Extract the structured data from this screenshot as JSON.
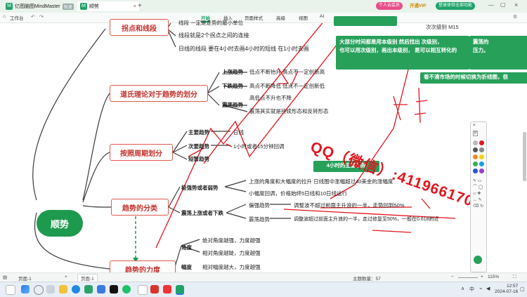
{
  "titlebar": {
    "tab1": "亿图脑图MindMaster",
    "tab1_badge": "极速",
    "tab2": "顺势",
    "badge_pink": "个人云会员",
    "vip": "开通VIP",
    "login": "登录体验全部功能"
  },
  "ribbon": {
    "workspace": "工作台",
    "tabs": [
      "开始",
      "插入",
      "页面样式",
      "高级",
      "视图",
      "AI"
    ],
    "active": "开始"
  },
  "map": {
    "central": "顺势",
    "topics": {
      "t1": "拐点和线段",
      "t2": "道氏理论对于趋势的划分",
      "t3": "按照周期划分",
      "t4": "趋势的分类",
      "t5": "趋势的力度"
    },
    "t1_items": [
      "线段 一定是走势的最小单位",
      "线段就是2个拐点之间的连接",
      "日线的线段 要在4小时去画4小时的短线 在1小时去画"
    ],
    "t2_items": {
      "up": "上涨趋势",
      "up_desc": "低点不断抬升 高点不一定创新高",
      "down": "下跌趋势",
      "down_desc": "高点不断降低 低点不一定创新低",
      "range": "震荡趋势",
      "range_desc1": "高低点不升也不降",
      "range_desc2": "震荡其实就是持续形态和反转形态"
    },
    "t3_items": {
      "main": "主要趋势",
      "main_desc": "日线",
      "second": "次要趋势",
      "second_desc": "1小时或者15分钟回调",
      "short": "短暂趋势"
    },
    "t4_items": {
      "strong": "极强势或者弱势",
      "strong_desc1": "上涨的角度和大幅度的拉升 日线图中涨幅超过40美金的涨幅度",
      "strong_desc2": "小幅度回调，价格始终5日线和10日线运行",
      "sideways": "震荡上涨或者下跌",
      "side_a": "偏强趋势",
      "side_a_desc": "调整波不超过前面主升浪的一半，走势回到50%",
      "side_b": "震荡趋势",
      "side_b_desc": "调整波超过前面主升浪的一半，走过修复至50%，一般在0.618附近"
    },
    "t5_items": {
      "angle": "角度",
      "angle_a": "绝对角度越强，力度越强",
      "angle_b": "相对角度越陡，力度越强",
      "amp": "幅度",
      "amp_a": "相对幅度越大，力度越强"
    },
    "note1": "大部分时间都是用本级别  然后找出 次级别，\n也可以用次级别，画出本级别，  是可以相互转化的",
    "note2": "看不清市场的时候切换为折线图，很",
    "note3a": "震荡的",
    "note3b": "压力。",
    "note4": "4小时的主要线段",
    "m15": "次次级别 M15",
    "qq": "QQ（微信）:411966170"
  },
  "status": {
    "page_left": "页面-1",
    "page_tab": "页面-1",
    "topic_count": "主题数量：57",
    "zoom": "115%"
  },
  "taskbar": {
    "time": "12:57",
    "date": "2024-07-16",
    "ime": "中"
  },
  "colors": {
    "brand_green": "#1e9a4e",
    "topic_red": "#e05a4f",
    "annotation_red": "#e3141c",
    "note_green": "#27a05a"
  }
}
